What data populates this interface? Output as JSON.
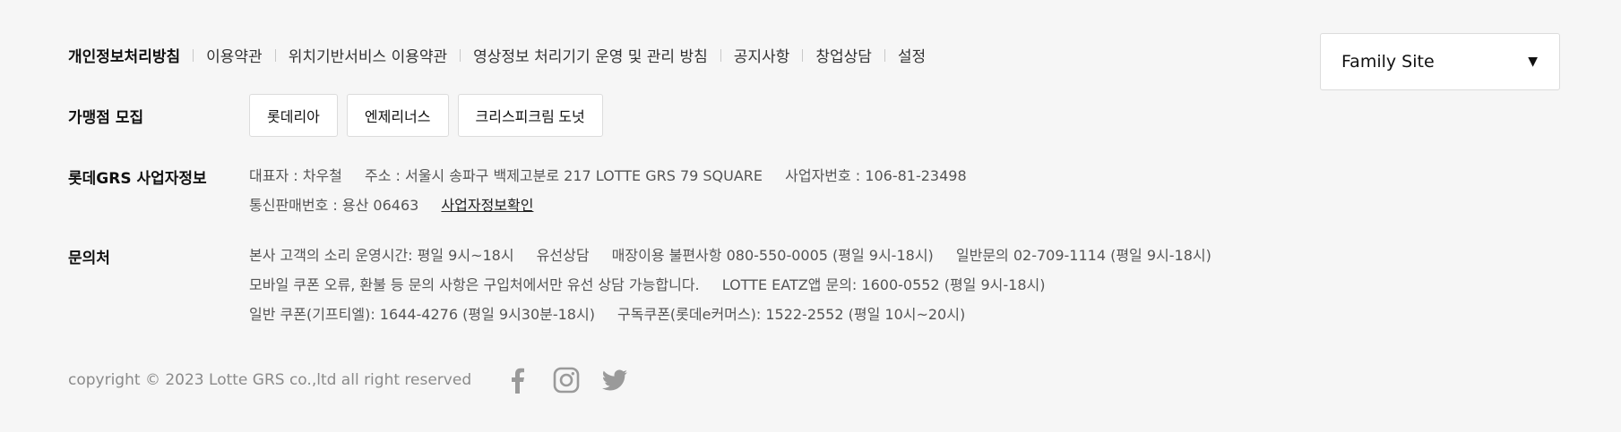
{
  "top_links": [
    {
      "label": "개인정보처리방침",
      "strong": true
    },
    {
      "label": "이용약관"
    },
    {
      "label": "위치기반서비스 이용약관"
    },
    {
      "label": "영상정보 처리기기 운영 및 관리 방침"
    },
    {
      "label": "공지사항"
    },
    {
      "label": "창업상담"
    },
    {
      "label": "설정"
    }
  ],
  "family_site": {
    "label": "Family Site"
  },
  "franchise": {
    "label": "가맹점 모집",
    "brands": [
      "롯데리아",
      "엔제리너스",
      "크리스피크림 도넛"
    ]
  },
  "business": {
    "label": "롯데GRS 사업자정보",
    "ceo": "대표자 : 차우철",
    "address": "주소 : 서울시 송파구 백제고분로 217 LOTTE GRS 79 SQUARE",
    "reg_no": "사업자번호 : 106-81-23498",
    "mail_order": "통신판매번호 : 용산 06463",
    "verify_link": "사업자정보확인"
  },
  "contact": {
    "label": "문의처",
    "line1": [
      "본사 고객의 소리 운영시간: 평일 9시~18시",
      "유선상담",
      "매장이용 불편사항 080-550-0005 (평일 9시-18시)",
      "일반문의 02-709-1114 (평일 9시-18시)"
    ],
    "line2": [
      "모바일 쿠폰 오류, 환불 등 문의 사항은 구입처에서만 유선 상담 가능합니다.",
      "LOTTE EATZ앱 문의: 1600-0552 (평일 9시-18시)"
    ],
    "line3": [
      "일반 쿠폰(기프티엘): 1644-4276 (평일 9시30분-18시)",
      "구독쿠폰(롯데e커머스): 1522-2552 (평일 10시~20시)"
    ]
  },
  "copyright": "copyright © 2023 Lotte GRS co.,ltd all right reserved",
  "social": [
    "facebook-icon",
    "instagram-icon",
    "twitter-icon"
  ],
  "colors": {
    "background": "#f6f6f6",
    "muted": "#8a8a8a",
    "icon": "#9a9a9a"
  }
}
